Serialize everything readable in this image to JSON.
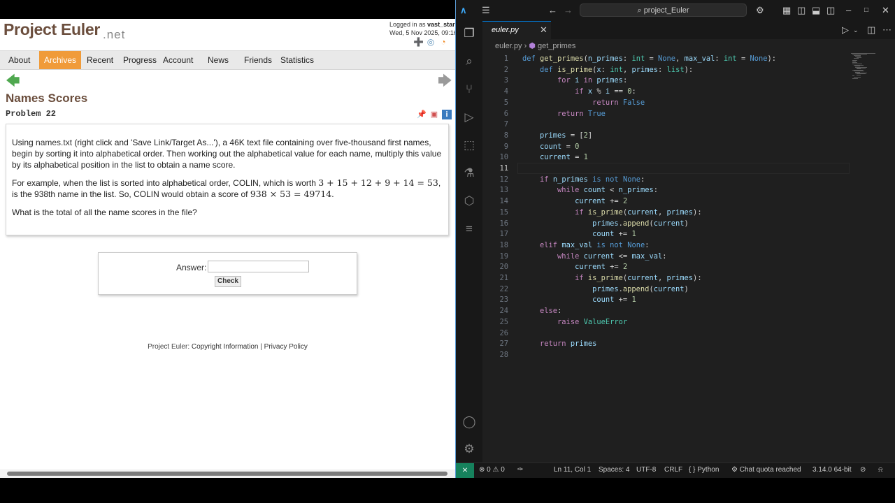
{
  "browser": {
    "logo": "Project Euler",
    "logo_suffix": ".net",
    "login_prefix": "Logged in as ",
    "login_user": "vast_stars",
    "login_date": "Wed, 5 Nov 2025, 09:16",
    "nav": [
      "About",
      "Archives",
      "Recent",
      "Progress",
      "Account",
      "News",
      "Friends",
      "Statistics"
    ],
    "nav_active": "Archives",
    "problem_title": "Names Scores",
    "problem_number": "Problem 22",
    "para1_a": "Using ",
    "para1_link": "names.txt",
    "para1_b": " (right click and 'Save Link/Target As...'), a 46K text file containing over five-thousand first names, begin by sorting it into alphabetical order. Then working out the alphabetical value for each name, multiply this value by its alphabetical position in the list to obtain a name score.",
    "para2_a": "For example, when the list is sorted into alphabetical order, COLIN, which is worth ",
    "para2_math1": "3 + 15 + 12 + 9 + 14 = 53",
    "para2_b": ", is the 938th name in the list. So, COLIN would obtain a score of ",
    "para2_math2": "938 × 53 = 49714",
    "para2_c": ".",
    "para3": "What is the total of all the name scores in the file?",
    "answer_label": "Answer:",
    "answer_value": "",
    "check_label": "Check",
    "footer_prefix": "Project Euler: ",
    "footer_link1": "Copyright Information",
    "footer_sep": " | ",
    "footer_link2": "Privacy Policy"
  },
  "vscode": {
    "search_text": "project_Euler",
    "tab_label": "euler.py",
    "breadcrumb_file": "euler.py",
    "breadcrumb_symbol": "get_primes",
    "status": {
      "errors": "0",
      "warnings": "0",
      "position": "Ln 11, Col 1",
      "spaces": "Spaces: 4",
      "encoding": "UTF-8",
      "eol": "CRLF",
      "language": "Python",
      "chat": "Chat quota reached",
      "interpreter": "3.14.0 64-bit"
    },
    "current_line": 11,
    "code_lines": [
      "def get_primes(n_primes: int = None, max_val: int = None):",
      "    def is_prime(x: int, primes: list):",
      "        for i in primes:",
      "            if x % i == 0:",
      "                return False",
      "        return True",
      "",
      "    primes = [2]",
      "    count = 0",
      "    current = 1",
      "",
      "    if n_primes is not None:",
      "        while count < n_primes:",
      "            current += 2",
      "            if is_prime(current, primes):",
      "                primes.append(current)",
      "                count += 1",
      "    elif max_val is not None:",
      "        while current <= max_val:",
      "            current += 2",
      "            if is_prime(current, primes):",
      "                primes.append(current)",
      "                count += 1",
      "    else:",
      "        raise ValueError",
      "",
      "    return primes",
      ""
    ]
  }
}
